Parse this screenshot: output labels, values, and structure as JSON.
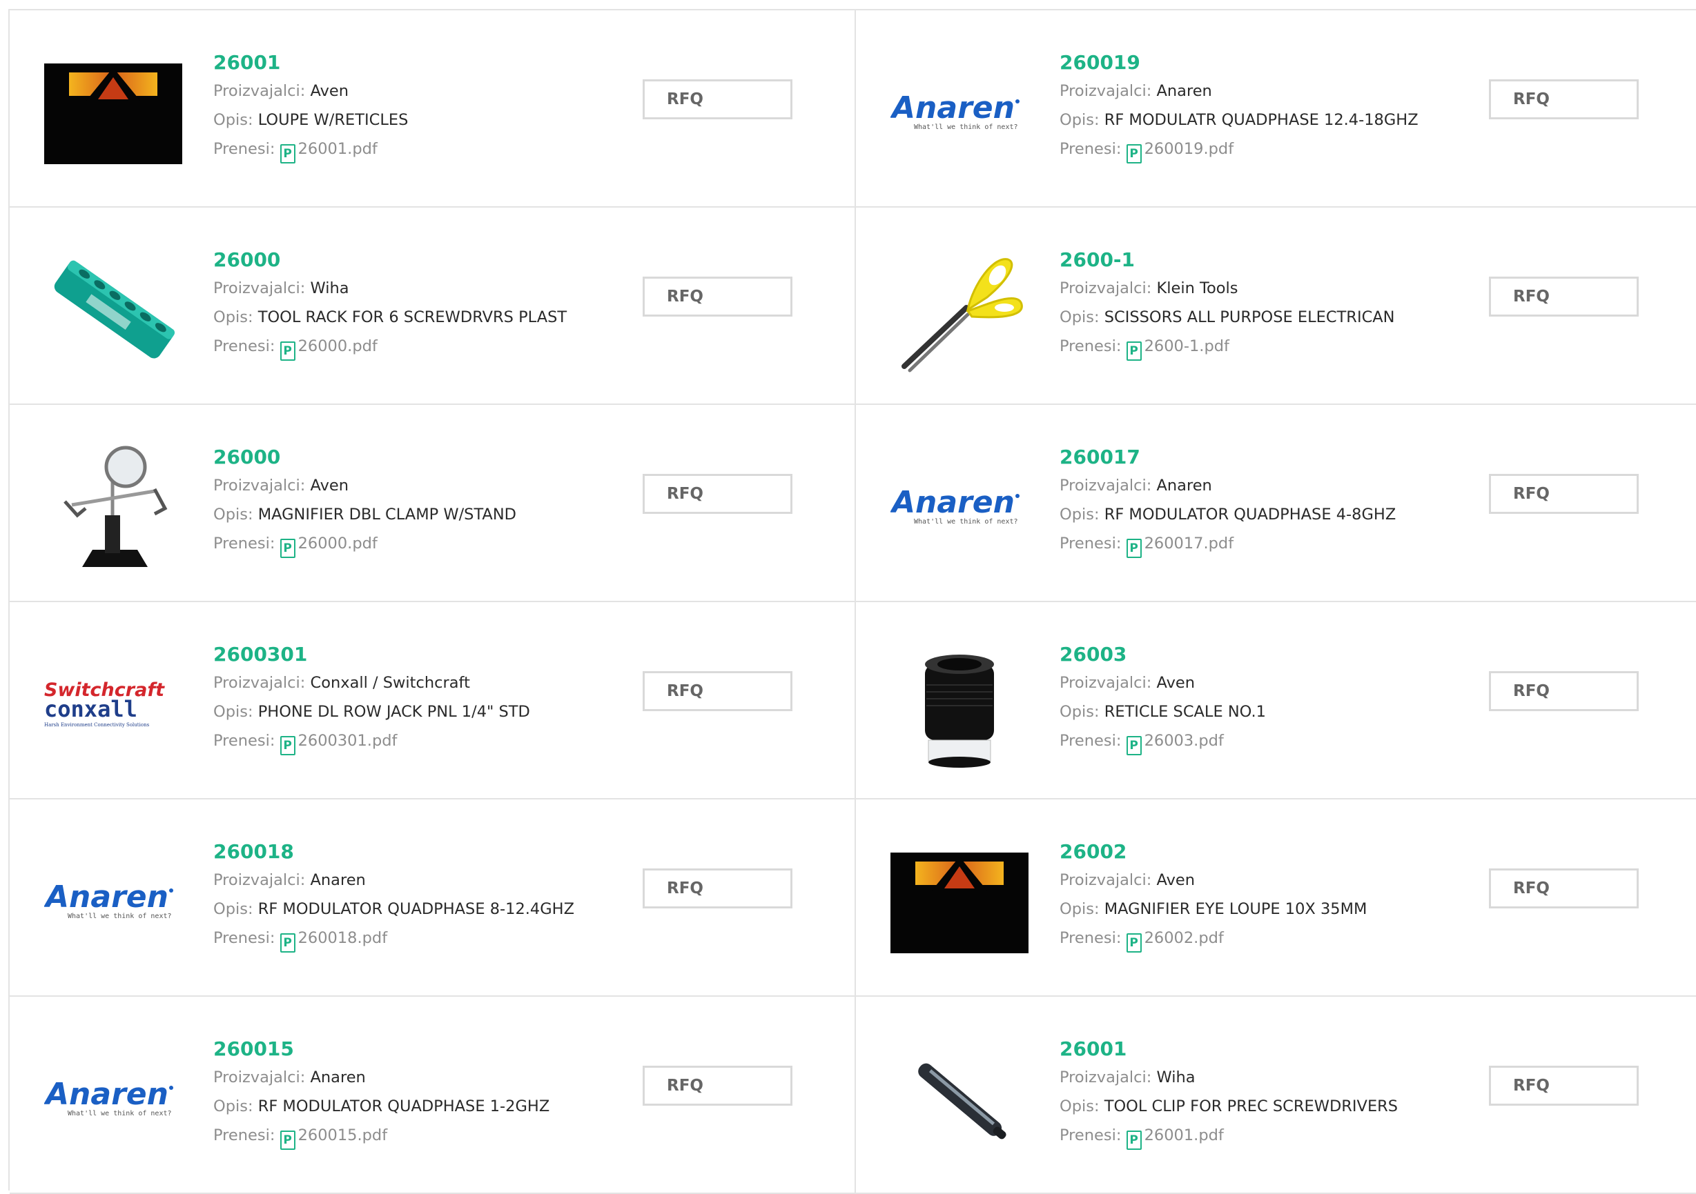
{
  "labels": {
    "manufacturer": "Proizvajalci:",
    "description": "Opis:",
    "download": "Prenesi:",
    "rfq": "RFQ",
    "pdf_glyph": "P"
  },
  "colors": {
    "part_number": "#1db386",
    "label": "#8d8d8d",
    "border": "#e3e3e3"
  },
  "products": [
    {
      "part": "26001",
      "manufacturer": "Aven",
      "description": "LOUPE W/RETICLES",
      "file": "26001.pdf",
      "image": "aven-dark"
    },
    {
      "part": "260019",
      "manufacturer": "Anaren",
      "description": "RF MODULATR QUADPHASE 12.4-18GHZ",
      "file": "260019.pdf",
      "image": "anaren-logo"
    },
    {
      "part": "26000",
      "manufacturer": "Wiha",
      "description": "TOOL RACK FOR 6 SCREWDRVRS PLAST",
      "file": "26000.pdf",
      "image": "tool-rack"
    },
    {
      "part": "2600-1",
      "manufacturer": "Klein Tools",
      "description": "SCISSORS ALL PURPOSE ELECTRICAN",
      "file": "2600-1.pdf",
      "image": "scissors"
    },
    {
      "part": "26000",
      "manufacturer": "Aven",
      "description": "MAGNIFIER DBL CLAMP W/STAND",
      "file": "26000.pdf",
      "image": "magnifier-stand"
    },
    {
      "part": "260017",
      "manufacturer": "Anaren",
      "description": "RF MODULATOR QUADPHASE 4-8GHZ",
      "file": "260017.pdf",
      "image": "anaren-logo"
    },
    {
      "part": "2600301",
      "manufacturer": "Conxall / Switchcraft",
      "description": "PHONE DL ROW JACK PNL 1/4\" STD",
      "file": "2600301.pdf",
      "image": "switchcraft-logo"
    },
    {
      "part": "26003",
      "manufacturer": "Aven",
      "description": "RETICLE SCALE NO.1",
      "file": "26003.pdf",
      "image": "loupe-lens"
    },
    {
      "part": "260018",
      "manufacturer": "Anaren",
      "description": "RF MODULATOR QUADPHASE 8-12.4GHZ",
      "file": "260018.pdf",
      "image": "anaren-logo"
    },
    {
      "part": "26002",
      "manufacturer": "Aven",
      "description": "MAGNIFIER EYE LOUPE 10X 35MM",
      "file": "26002.pdf",
      "image": "aven-dark"
    },
    {
      "part": "260015",
      "manufacturer": "Anaren",
      "description": "RF MODULATOR QUADPHASE 1-2GHZ",
      "file": "260015.pdf",
      "image": "anaren-logo"
    },
    {
      "part": "26001",
      "manufacturer": "Wiha",
      "description": "TOOL CLIP FOR PREC SCREWDRIVERS",
      "file": "26001.pdf",
      "image": "tool-clip"
    }
  ],
  "logos": {
    "anaren": {
      "name": "Anaren",
      "tagline": "What'll we think of next?"
    },
    "switchcraft": {
      "name": "Switchcraft",
      "sub": "conxall",
      "tagline": "Harsh Environment Connectivity Solutions"
    }
  }
}
